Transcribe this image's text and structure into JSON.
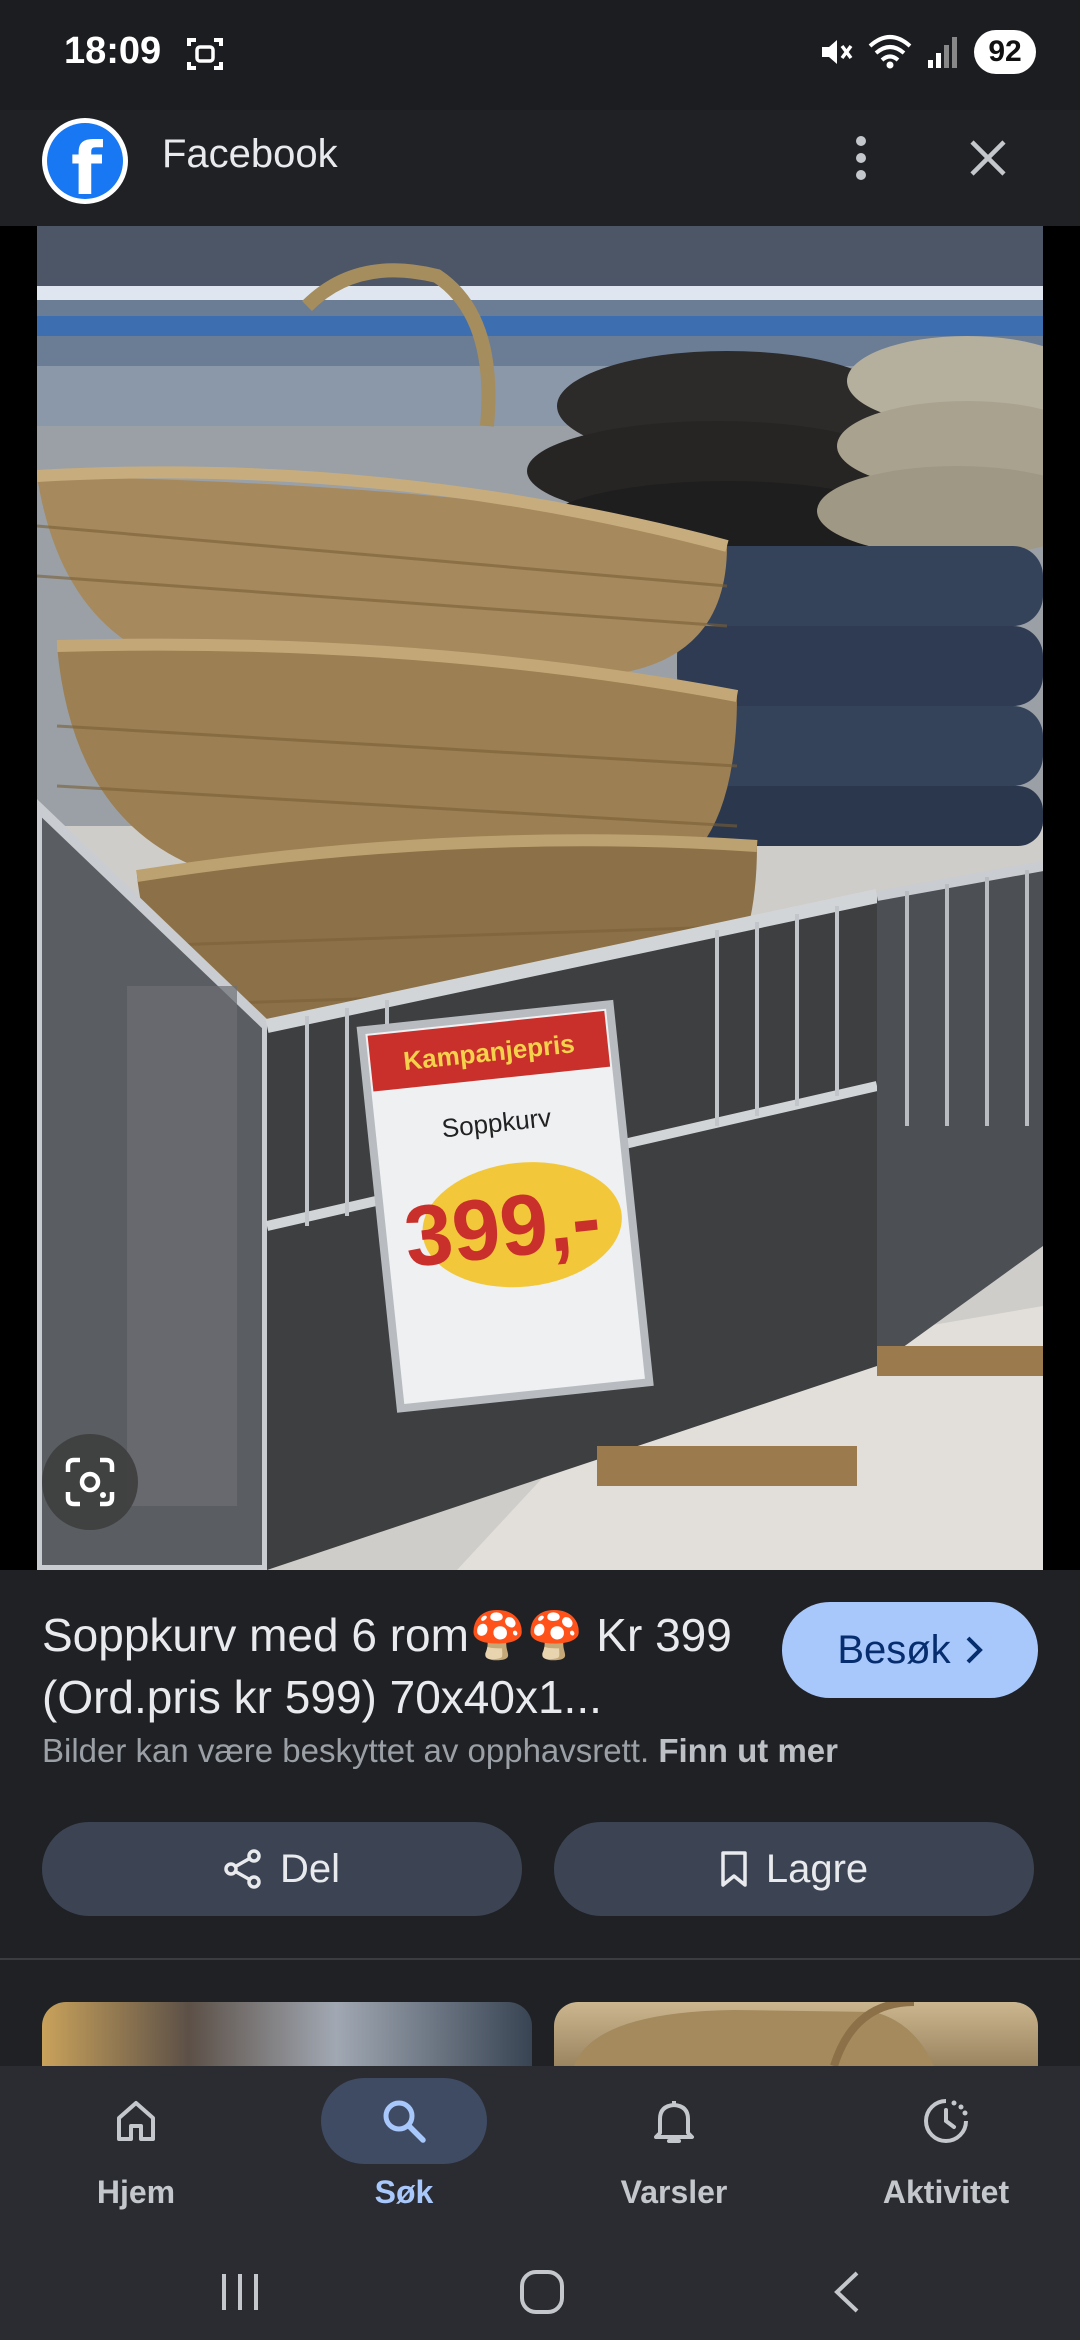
{
  "status_bar": {
    "time": "18:09",
    "battery": "92",
    "icons": [
      "screenshot-icon",
      "mute-icon",
      "wifi-icon",
      "signal-icon"
    ]
  },
  "header": {
    "title": "Facebook",
    "logo_icon": "facebook-logo",
    "more_icon": "more-vert-icon",
    "close_icon": "close-icon",
    "brand_color": "#1877f2"
  },
  "image": {
    "sign_price": "399,-",
    "sign_product": "Soppkurv",
    "sign_banner": "Kampanjepris"
  },
  "result": {
    "title": "Soppkurv med 6 rom🍄🍄 Kr 399 (Ord.pris kr 599) 70x40x1...",
    "visit_label": "Besøk",
    "copyright_text": "Bilder kan være beskyttet av opphavsrett.",
    "learn_more": "Finn ut mer",
    "share_label": "Del",
    "save_label": "Lagre",
    "accent_color": "#a8c7fa"
  },
  "bottom_nav": {
    "items": [
      {
        "label": "Hjem",
        "icon": "home-icon",
        "active": false
      },
      {
        "label": "Søk",
        "icon": "search-icon",
        "active": true
      },
      {
        "label": "Varsler",
        "icon": "bell-icon",
        "active": false
      },
      {
        "label": "Aktivitet",
        "icon": "activity-icon",
        "active": false
      }
    ]
  }
}
